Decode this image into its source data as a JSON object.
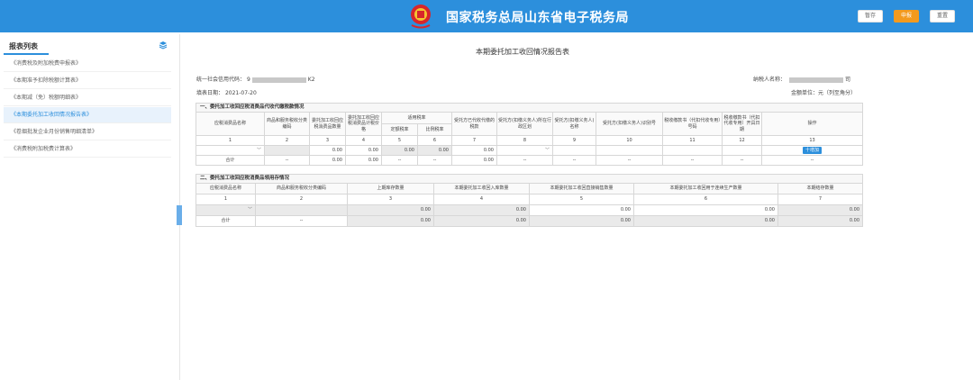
{
  "header": {
    "title": "国家税务总局山东省电子税务局",
    "buttons": {
      "save": "暂存",
      "submit": "申报",
      "reset": "重置"
    },
    "accent_color": "#2c8fdc",
    "submit_color": "#f39a1e"
  },
  "sidebar": {
    "title": "报表列表",
    "items": [
      "《消费税及附加税费申报表》",
      "《本期准予扣除税额计算表》",
      "《本期减（免）税额明细表》",
      "《本期委托加工收回情况报告表》",
      "《卷烟批发企业月份销售明细清单》",
      "《消费税附加税费计算表》"
    ],
    "active_index": 3
  },
  "form": {
    "title": "本期委托加工收回情况报告表",
    "credit_code_label": "统一社会信用代码：",
    "credit_code_prefix": "9",
    "credit_code_suffix": "K2",
    "taxpayer_label": "纳税人名称：",
    "taxpayer_prefix": "",
    "taxpayer_suffix": "司",
    "fill_date_label": "填表日期：",
    "fill_date": "2021-07-20",
    "unit": "金额单位：元（列至角分）"
  },
  "table1": {
    "section_title": "一、委托加工收回应税消费品代收代缴税款情况",
    "headers": {
      "c1": "应税消费品名称",
      "c2": "商品和服务税收分类编码",
      "c3": "委托加工收回应税消费品数量",
      "c4": "委托加工收回应税消费品计税价格",
      "rate_group": "适用税率",
      "c5": "定额税率",
      "c6": "比例税率",
      "c7": "受托方已代收代缴的税款",
      "c8": "受托方(扣缴义务人)所在行政区划",
      "c9": "受托方(扣缴义务人)名称",
      "c10": "受托方(扣缴义务人)识别号",
      "c11": "税收缴款书（代扣代收专用）号码",
      "c12": "税收缴款书（代扣代收专用）开具日期",
      "c13": "操作"
    },
    "numbers": [
      "1",
      "2",
      "3",
      "4",
      "5",
      "6",
      "7",
      "8",
      "9",
      "10",
      "11",
      "12",
      "13"
    ],
    "row": {
      "c3": "0.00",
      "c4": "0.00",
      "c5": "0.00",
      "c6": "0.00",
      "c7": "0.00",
      "add": "十增加"
    },
    "total": {
      "label": "合计",
      "c2": "--",
      "c3": "0.00",
      "c4": "0.00",
      "c5": "--",
      "c6": "--",
      "c7": "0.00",
      "c8": "--",
      "c9": "--",
      "c10": "--",
      "c11": "--",
      "c12": "--",
      "c13": "--"
    }
  },
  "table2": {
    "section_title": "二、委托加工收回应税消费品领用存情况",
    "headers": [
      "应税消费品名称",
      "商品和服务税收分类编码",
      "上期库存数量",
      "本期委托加工收回入库数量",
      "本期委托加工收回直接销售数量",
      "本期委托加工收回用于连续生产数量",
      "本期结存数量"
    ],
    "numbers": [
      "1",
      "2",
      "3",
      "4",
      "5",
      "6",
      "7"
    ],
    "row": [
      "",
      "",
      "0.00",
      "0.00",
      "0.00",
      "0.00",
      "0.00"
    ],
    "total": [
      "合计",
      "--",
      "0.00",
      "0.00",
      "0.00",
      "0.00",
      "0.00"
    ]
  }
}
